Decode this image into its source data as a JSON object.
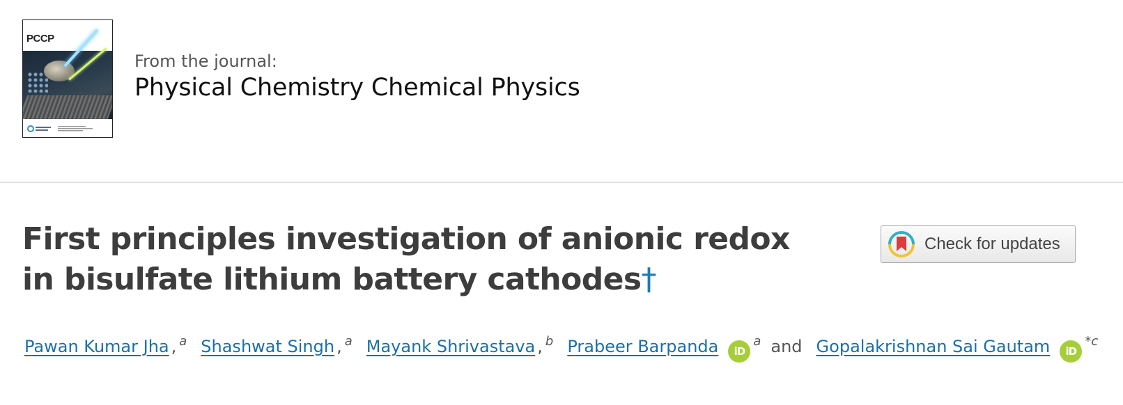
{
  "journal": {
    "cover_title": "PCCP",
    "from_label": "From the journal:",
    "name": "Physical Chemistry Chemical Physics"
  },
  "article": {
    "title": "First principles investigation of anionic redox in bisulfate lithium battery cathodes",
    "footnote_mark": "†"
  },
  "updates_button": {
    "label": "Check for updates",
    "icon": "crossmark-icon"
  },
  "authors": [
    {
      "name": "Pawan Kumar Jha",
      "affil": "a",
      "orcid": false
    },
    {
      "name": "Shashwat Singh",
      "affil": "a",
      "orcid": false
    },
    {
      "name": "Mayank Shrivastava",
      "affil": "b",
      "orcid": false
    },
    {
      "name": "Prabeer Barpanda",
      "affil": "a",
      "orcid": true
    },
    {
      "name": "Gopalakrishnan Sai Gautam",
      "affil": "*c",
      "orcid": true
    }
  ],
  "authors_conjunction": "and",
  "colors": {
    "link": "#1a70a8",
    "orcid": "#a6ce39",
    "title": "#3d3d3d"
  }
}
